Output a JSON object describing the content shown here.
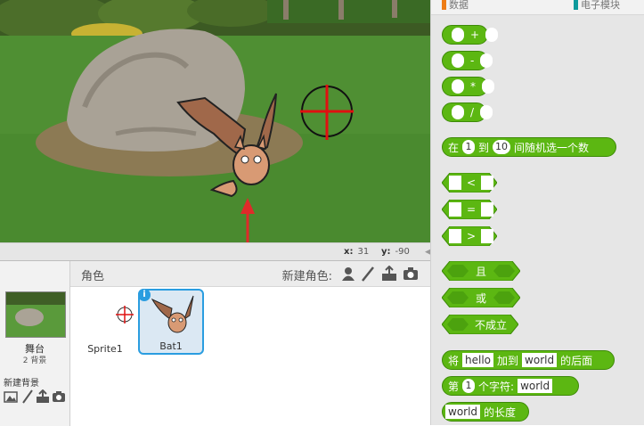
{
  "stage": {
    "x_label": "x:",
    "x_value": "31",
    "y_label": "y:",
    "y_value": "-90"
  },
  "sprite_pane": {
    "title": "角色",
    "new_sprite_label": "新建角色:",
    "stage_label": "舞台",
    "backdrop_count": "2 背景",
    "new_backdrop_label": "新建背景",
    "sprites": [
      {
        "name": "Sprite1",
        "selected": false
      },
      {
        "name": "Bat1",
        "selected": true
      }
    ],
    "info_badge": "i"
  },
  "palette": {
    "categories": [
      {
        "label": "数据",
        "color": "#ee7d16"
      },
      {
        "label": "电子模块",
        "color": "#0e9a9c"
      }
    ],
    "block_color": "#5cb712",
    "blocks": {
      "add": "+",
      "subtract": "-",
      "multiply": "*",
      "divide": "/",
      "random_prefix": "在",
      "random_from": "1",
      "random_to_word": "到",
      "random_to": "10",
      "random_suffix": "间随机选一个数",
      "less_than": "<",
      "equals": "=",
      "greater_than": ">",
      "and": "且",
      "or": "或",
      "not": "不成立",
      "join_prefix": "将",
      "join_a": "hello",
      "join_mid": "加到",
      "join_b": "world",
      "join_suffix": "的后面",
      "letter_prefix": "第",
      "letter_index": "1",
      "letter_mid": "个字符:",
      "letter_word": "world",
      "length_word": "world",
      "length_suffix": "的长度"
    }
  }
}
